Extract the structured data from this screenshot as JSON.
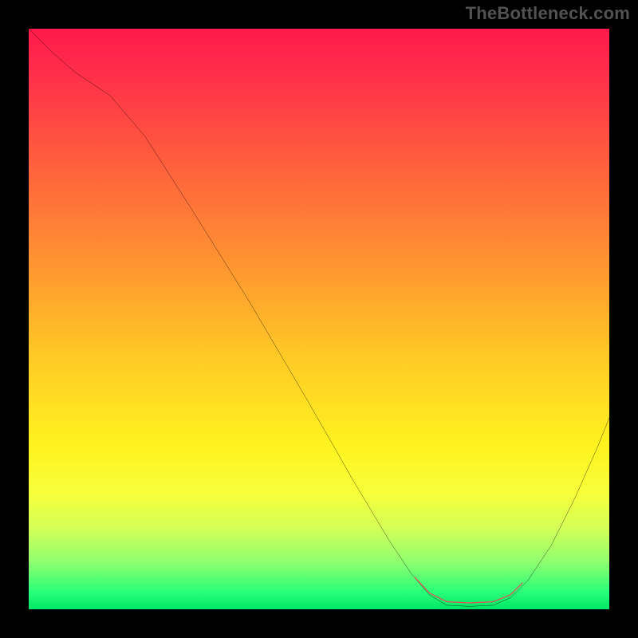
{
  "watermark": "TheBottleneck.com",
  "chart_data": {
    "type": "line",
    "title": "",
    "xlabel": "",
    "ylabel": "",
    "xlim": [
      0,
      100
    ],
    "ylim": [
      0,
      100
    ],
    "series": [
      {
        "name": "black-curve",
        "color": "#000000",
        "points": [
          {
            "x": 0,
            "y": 100
          },
          {
            "x": 4,
            "y": 96
          },
          {
            "x": 8,
            "y": 92.5
          },
          {
            "x": 14,
            "y": 88.5
          },
          {
            "x": 20,
            "y": 81.5
          },
          {
            "x": 28,
            "y": 69
          },
          {
            "x": 38,
            "y": 53
          },
          {
            "x": 48,
            "y": 36
          },
          {
            "x": 56,
            "y": 22
          },
          {
            "x": 62,
            "y": 12
          },
          {
            "x": 66,
            "y": 6
          },
          {
            "x": 69,
            "y": 2.5
          },
          {
            "x": 72,
            "y": 0.7
          },
          {
            "x": 76,
            "y": 0.5
          },
          {
            "x": 80,
            "y": 0.7
          },
          {
            "x": 83,
            "y": 2
          },
          {
            "x": 86,
            "y": 5
          },
          {
            "x": 90,
            "y": 11
          },
          {
            "x": 94,
            "y": 19
          },
          {
            "x": 98,
            "y": 28
          },
          {
            "x": 100,
            "y": 33
          }
        ]
      },
      {
        "name": "red-highlight-band",
        "color": "#d85a5a",
        "points": [
          {
            "x": 66.5,
            "y": 5.5
          },
          {
            "x": 69,
            "y": 2.8
          },
          {
            "x": 72,
            "y": 1.3
          },
          {
            "x": 76,
            "y": 1.1
          },
          {
            "x": 80,
            "y": 1.3
          },
          {
            "x": 83,
            "y": 2.5
          },
          {
            "x": 85,
            "y": 4.5
          }
        ]
      }
    ],
    "gradient_stops": [
      {
        "pos": 0,
        "color": "#ff1a4b"
      },
      {
        "pos": 50,
        "color": "#ffb428"
      },
      {
        "pos": 75,
        "color": "#fff31f"
      },
      {
        "pos": 100,
        "color": "#00e765"
      }
    ]
  }
}
